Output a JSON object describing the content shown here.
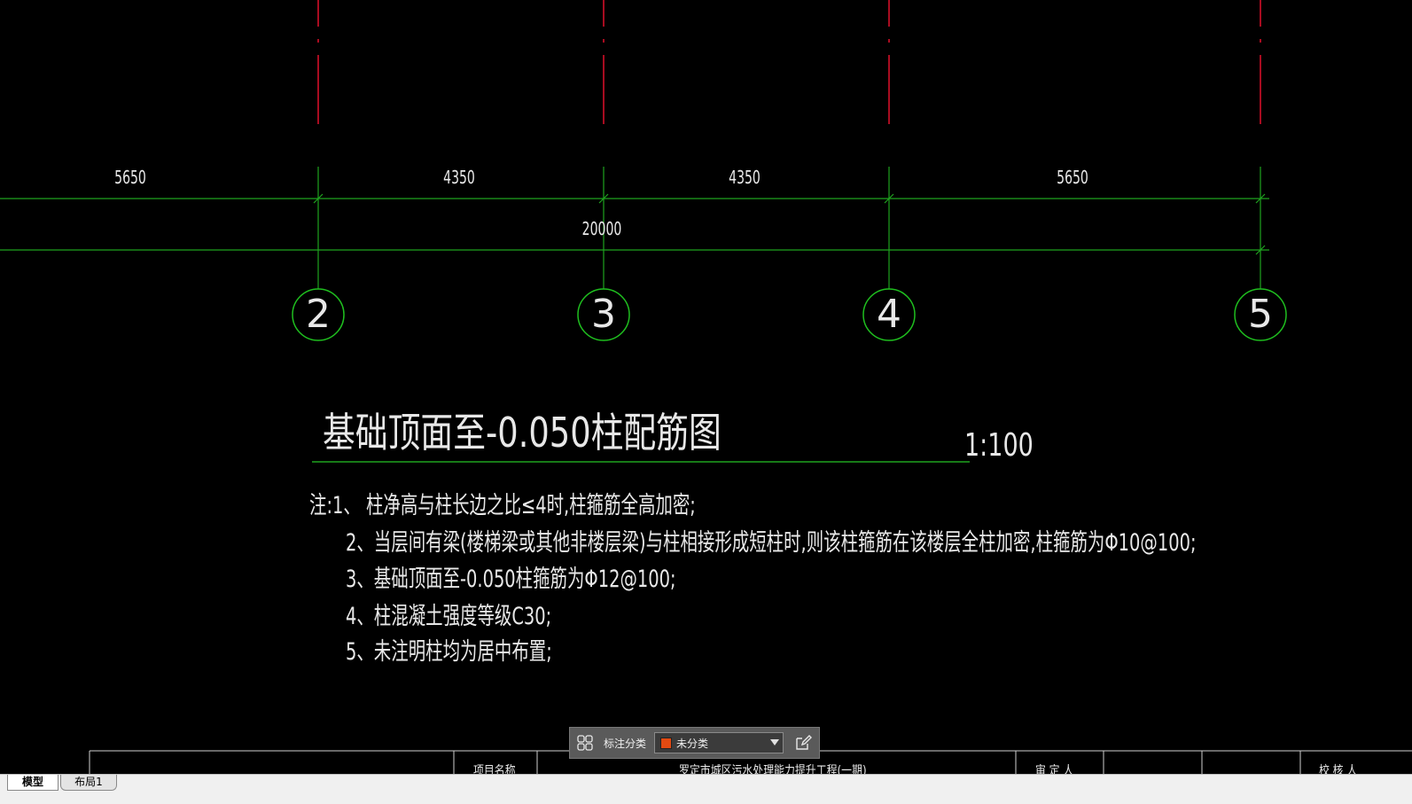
{
  "drawing": {
    "dimensions_segments": [
      "5650",
      "4350",
      "4350",
      "5650"
    ],
    "dimension_total": "20000",
    "axis_labels": [
      "2",
      "3",
      "4",
      "5"
    ],
    "title": "基础顶面至-0.050柱配筋图",
    "scale": "1:100",
    "notes": [
      "注:1、  柱净高与柱长边之比≤4时,柱箍筋全高加密;",
      "2、当层间有梁(楼梯梁或其他非楼层梁)与柱相接形成短柱时,则该柱箍筋在该楼层全柱加密,柱箍筋为Φ10@100;",
      "3、基础顶面至-0.050柱箍筋为Φ12@100;",
      "4、柱混凝土强度等级C30;",
      "5、未注明柱均为居中布置;"
    ],
    "colors": {
      "axis_line": "#e0102a",
      "dim_line": "#1fa31f",
      "circle": "#1fbf1f",
      "text": "#e8e8e8"
    }
  },
  "title_block": {
    "project_name_label": "项目名称",
    "project_name_value": "罗定市城区污水处理能力提升工程(一期)",
    "approver_label": "审 定 人",
    "checker_label": "校 核 人"
  },
  "annotation_toolbar": {
    "icon": "grid-icon",
    "label": "标注分类",
    "selected": "未分类",
    "swatch_color": "#e24a12",
    "edit_icon": "edit-icon"
  },
  "tabs": [
    {
      "label": "模型"
    },
    {
      "label": "布局1"
    }
  ]
}
